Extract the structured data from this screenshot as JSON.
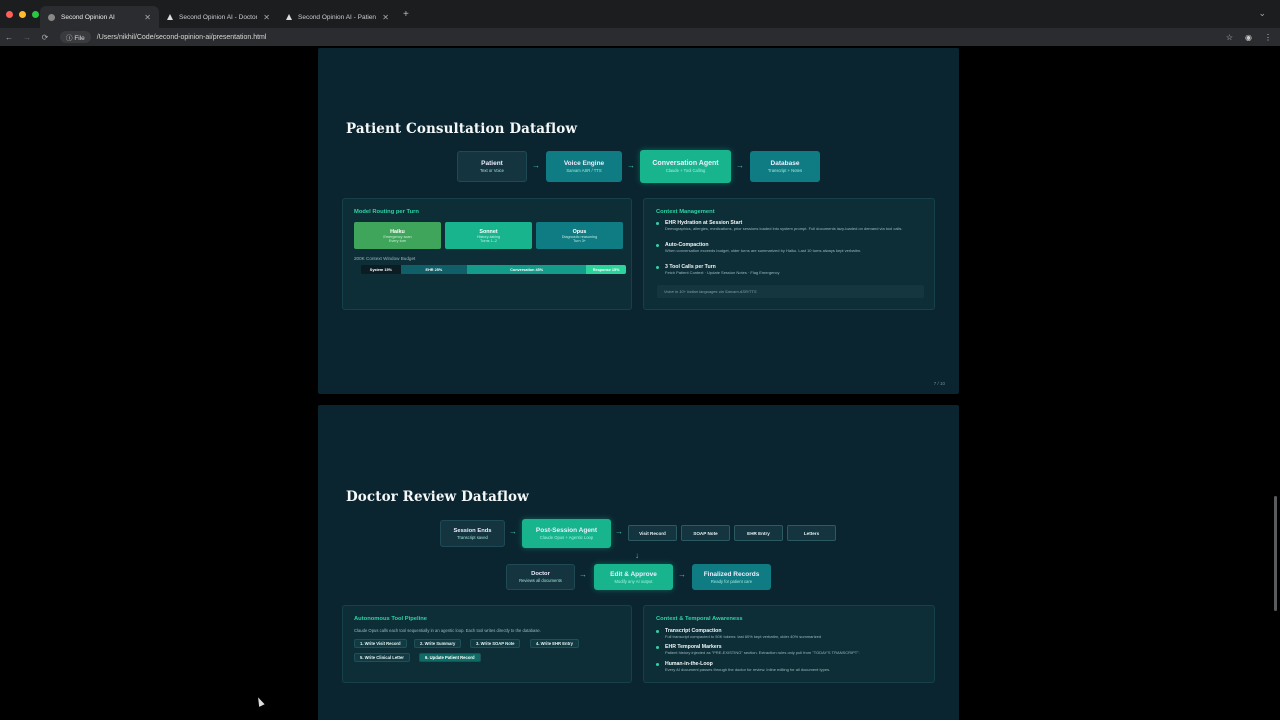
{
  "browser": {
    "tabs": [
      {
        "title": "Second Opinion AI",
        "active": true
      },
      {
        "title": "Second Opinion AI - Doctor P",
        "active": false
      },
      {
        "title": "Second Opinion AI - Patient P",
        "active": false
      }
    ],
    "new_tab": "+",
    "nav": {
      "back": "←",
      "forward": "→",
      "reload": "⟳"
    },
    "file_chip": "File",
    "url": "/Users/nikhil/Code/second-opinion-ai/presentation.html",
    "traffic_colors": [
      "#ff5f57",
      "#febc2e",
      "#28c840"
    ]
  },
  "slide1": {
    "title": "Patient Consultation Dataflow",
    "flow": [
      {
        "title": "Patient",
        "sub": "Text or Voice"
      },
      {
        "title": "Voice Engine",
        "sub": "Sarvam ASR / TTS"
      },
      {
        "title": "Conversation Agent",
        "sub": "Claude + Tool Calling"
      },
      {
        "title": "Database",
        "sub": "Transcript + Notes"
      }
    ],
    "routing": {
      "header": "Model Routing per Turn",
      "models": [
        {
          "name": "Haiku",
          "desc": "Emergency scan",
          "when": "Every turn"
        },
        {
          "name": "Sonnet",
          "desc": "History-taking",
          "when": "Turns 1–2"
        },
        {
          "name": "Opus",
          "desc": "Diagnostic reasoning",
          "when": "Turn 3+"
        }
      ],
      "budget_label": "200K Context Window Budget",
      "budget": [
        {
          "label": "System 15%",
          "pct": 15
        },
        {
          "label": "EHR 25%",
          "pct": 25
        },
        {
          "label": "Conversation 45%",
          "pct": 45
        },
        {
          "label": "Response 15%",
          "pct": 15
        }
      ]
    },
    "context": {
      "header": "Context Management",
      "items": [
        {
          "title": "EHR Hydration at Session Start",
          "body": "Demographics, allergies, medications, prior sessions loaded into system prompt. Full documents lazy-loaded on demand via tool calls."
        },
        {
          "title": "Auto-Compaction",
          "body": "When conversation exceeds budget, older turns are summarized by Haiku. Last 10 turns always kept verbatim."
        },
        {
          "title": "3 Tool Calls per Turn",
          "body": "Fetch Patient Context · Update Session Notes · Flag Emergency"
        }
      ],
      "note": "Voice in 10+ Indian languages via Sarvam ASR/TTS"
    },
    "page": "7 / 10"
  },
  "slide2": {
    "title": "Doctor Review Dataflow",
    "session_ends": {
      "title": "Session Ends",
      "sub": "Transcript saved"
    },
    "agent": {
      "title": "Post-Session Agent",
      "sub": "Claude Opus + Agentic Loop"
    },
    "outputs": [
      "Visit Record",
      "SOAP Note",
      "EHR Entry",
      "Letters"
    ],
    "doctor": {
      "title": "Doctor",
      "sub": "Reviews all documents"
    },
    "edit": {
      "title": "Edit & Approve",
      "sub": "Modify any AI output"
    },
    "final": {
      "title": "Finalized Records",
      "sub": "Ready for patient care"
    },
    "pipeline": {
      "header": "Autonomous Tool Pipeline",
      "desc": "Claude Opus calls each tool sequentially in an agentic loop. Each tool writes directly to the database.",
      "steps": [
        "1. Write Visit Record",
        "2. Write Summary",
        "3. Write SOAP Note",
        "4. Write EHR Entry",
        "5. Write Clinical Letter",
        "6. Update Patient Record"
      ]
    },
    "temporal": {
      "header": "Context & Temporal Awareness",
      "items": [
        {
          "title": "Transcript Compaction",
          "body": "Full transcript compacted to 50K tokens: last 60% kept verbatim, older 40% summarized"
        },
        {
          "title": "EHR Temporal Markers",
          "body": "Patient history injected as \"PRE-EXISTING\" section. Extraction rules only pull from \"TODAY'S TRANSCRIPT\"."
        },
        {
          "title": "Human-in-the-Loop",
          "body": "Every AI document passes through the doctor for review. Inline editing for all document types."
        }
      ]
    }
  },
  "colors": {
    "slide_bg": "#0b2530",
    "accent": "#2dd4a6",
    "teal": "#0f7b82",
    "bright": "#17b48e",
    "haiku": "#3fa55a"
  }
}
